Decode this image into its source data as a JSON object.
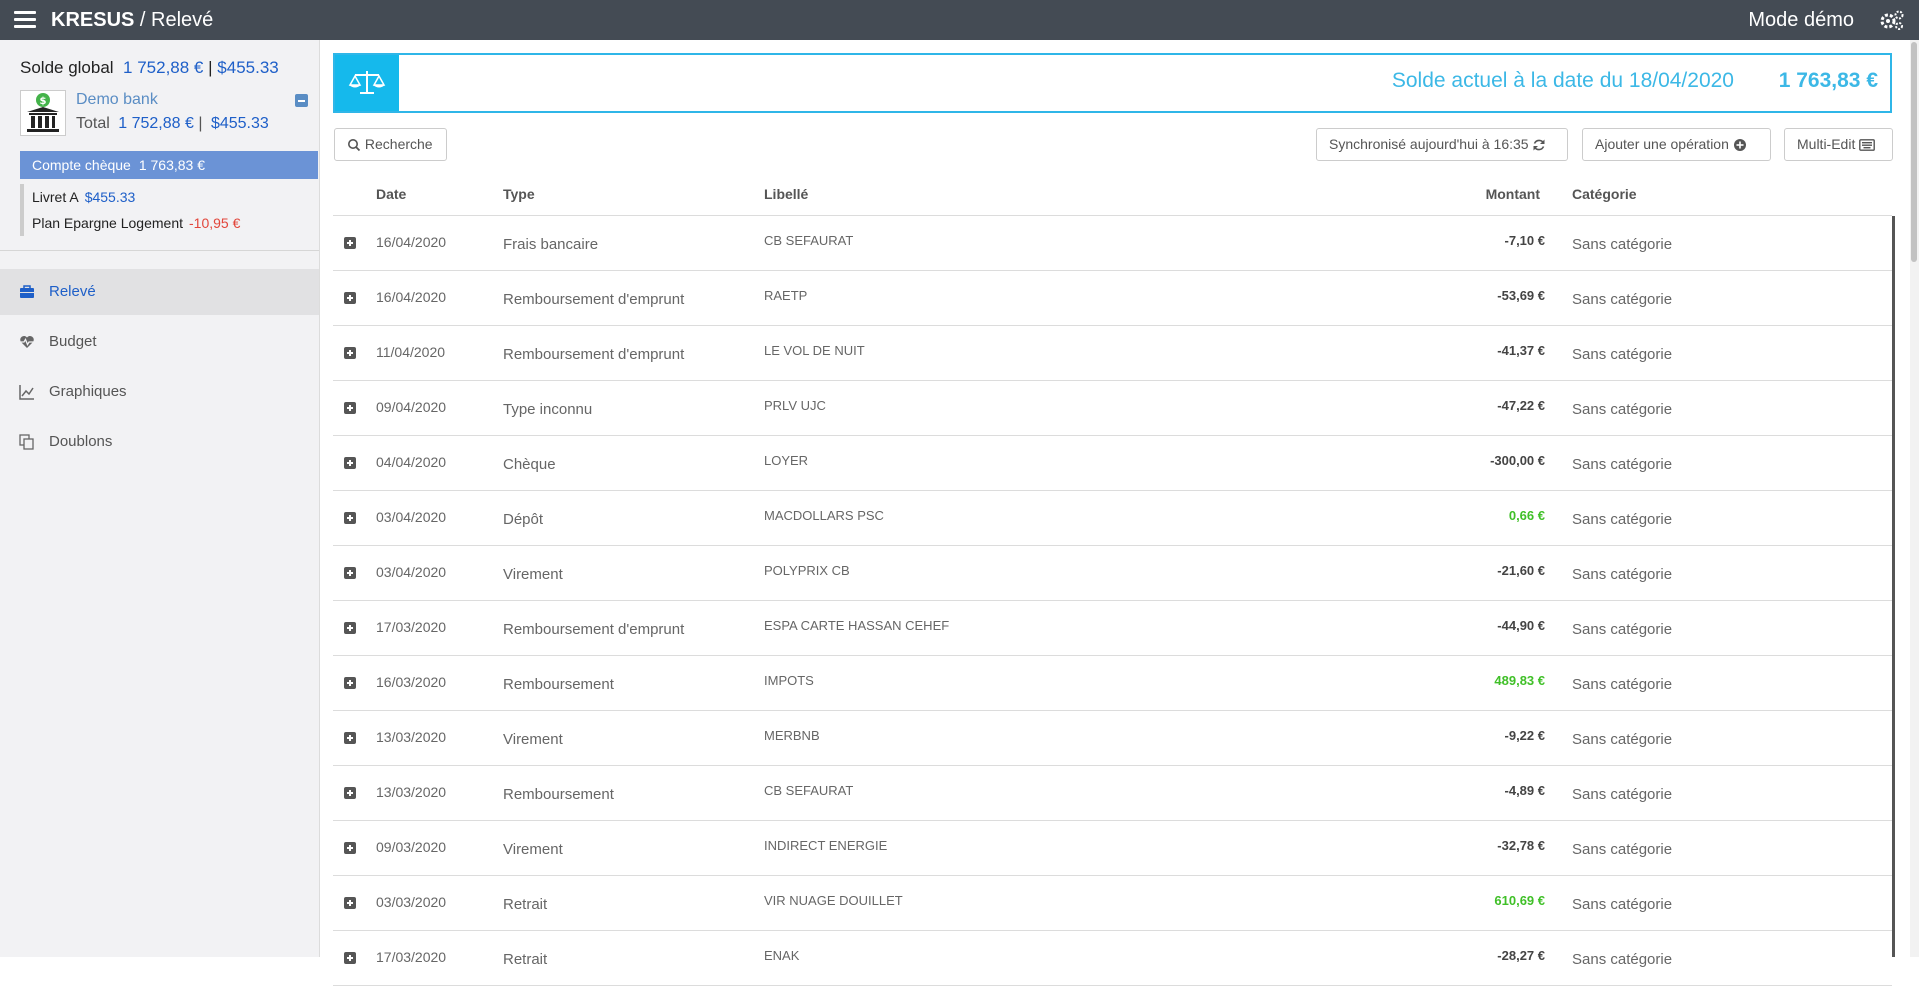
{
  "header": {
    "app_name": "KRESUS",
    "separator": " / ",
    "page": "Relevé",
    "mode": "Mode démo"
  },
  "sidebar": {
    "global_label": "Solde global",
    "global_eur": "1 752,88 €",
    "global_sep": "|",
    "global_usd": "$455.33",
    "bank": {
      "name": "Demo bank",
      "total_label": "Total",
      "total_eur": "1 752,88 €",
      "total_sep": "|",
      "total_usd": "$455.33"
    },
    "accounts": [
      {
        "name": "Compte chèque",
        "balance": "1 763,83 €"
      },
      {
        "name": "Livret A",
        "balance": "$455.33"
      },
      {
        "name": "Plan Epargne Logement",
        "balance": "-10,95 €"
      }
    ],
    "nav": [
      {
        "label": "Relevé"
      },
      {
        "label": "Budget"
      },
      {
        "label": "Graphiques"
      },
      {
        "label": "Doublons"
      }
    ]
  },
  "balance": {
    "label": "Solde actuel à la date du 18/04/2020",
    "value": "1 763,83 €"
  },
  "toolbar": {
    "search": "Recherche",
    "sync": "Synchronisé aujourd'hui à 16:35",
    "add": "Ajouter une opération",
    "multi": "Multi-Edit"
  },
  "table": {
    "headers": {
      "date": "Date",
      "type": "Type",
      "label": "Libellé",
      "amount": "Montant",
      "category": "Catégorie"
    },
    "rows": [
      {
        "date": "16/04/2020",
        "type": "Frais bancaire",
        "label": "CB SEFAURAT",
        "amount": "-7,10 €",
        "category": "Sans catégorie"
      },
      {
        "date": "16/04/2020",
        "type": "Remboursement d'emprunt",
        "label": "RAETP",
        "amount": "-53,69 €",
        "category": "Sans catégorie"
      },
      {
        "date": "11/04/2020",
        "type": "Remboursement d'emprunt",
        "label": "LE VOL DE NUIT",
        "amount": "-41,37 €",
        "category": "Sans catégorie"
      },
      {
        "date": "09/04/2020",
        "type": "Type inconnu",
        "label": "PRLV UJC",
        "amount": "-47,22 €",
        "category": "Sans catégorie"
      },
      {
        "date": "04/04/2020",
        "type": "Chèque",
        "label": "LOYER",
        "amount": "-300,00 €",
        "category": "Sans catégorie"
      },
      {
        "date": "03/04/2020",
        "type": "Dépôt",
        "label": "MACDOLLARS PSC",
        "amount": "0,66 €",
        "category": "Sans catégorie"
      },
      {
        "date": "03/04/2020",
        "type": "Virement",
        "label": "POLYPRIX CB",
        "amount": "-21,60 €",
        "category": "Sans catégorie"
      },
      {
        "date": "17/03/2020",
        "type": "Remboursement d'emprunt",
        "label": "ESPA CARTE HASSAN CEHEF",
        "amount": "-44,90 €",
        "category": "Sans catégorie"
      },
      {
        "date": "16/03/2020",
        "type": "Remboursement",
        "label": "IMPOTS",
        "amount": "489,83 €",
        "category": "Sans catégorie"
      },
      {
        "date": "13/03/2020",
        "type": "Virement",
        "label": "MERBNB",
        "amount": "-9,22 €",
        "category": "Sans catégorie"
      },
      {
        "date": "13/03/2020",
        "type": "Remboursement",
        "label": "CB SEFAURAT",
        "amount": "-4,89 €",
        "category": "Sans catégorie"
      },
      {
        "date": "09/03/2020",
        "type": "Virement",
        "label": "INDIRECT ENERGIE",
        "amount": "-32,78 €",
        "category": "Sans catégorie"
      },
      {
        "date": "03/03/2020",
        "type": "Retrait",
        "label": "VIR NUAGE DOUILLET",
        "amount": "610,69 €",
        "category": "Sans catégorie"
      },
      {
        "date": "17/03/2020",
        "type": "Retrait",
        "label": "ENAK",
        "amount": "-28,27 €",
        "category": "Sans catégorie"
      }
    ]
  },
  "colors": {
    "topbar": "#444b54",
    "accent_blue": "#1e5fc8",
    "balance_cyan": "#2fb6e8",
    "positive": "#40c028",
    "negative": "#e2463b"
  },
  "icons": {
    "menu": "hamburger-icon",
    "settings": "gears-icon",
    "balance": "scale-icon",
    "search": "search-icon",
    "sync": "refresh-icon",
    "add": "plus-circle-icon",
    "multi": "keyboard-icon"
  }
}
